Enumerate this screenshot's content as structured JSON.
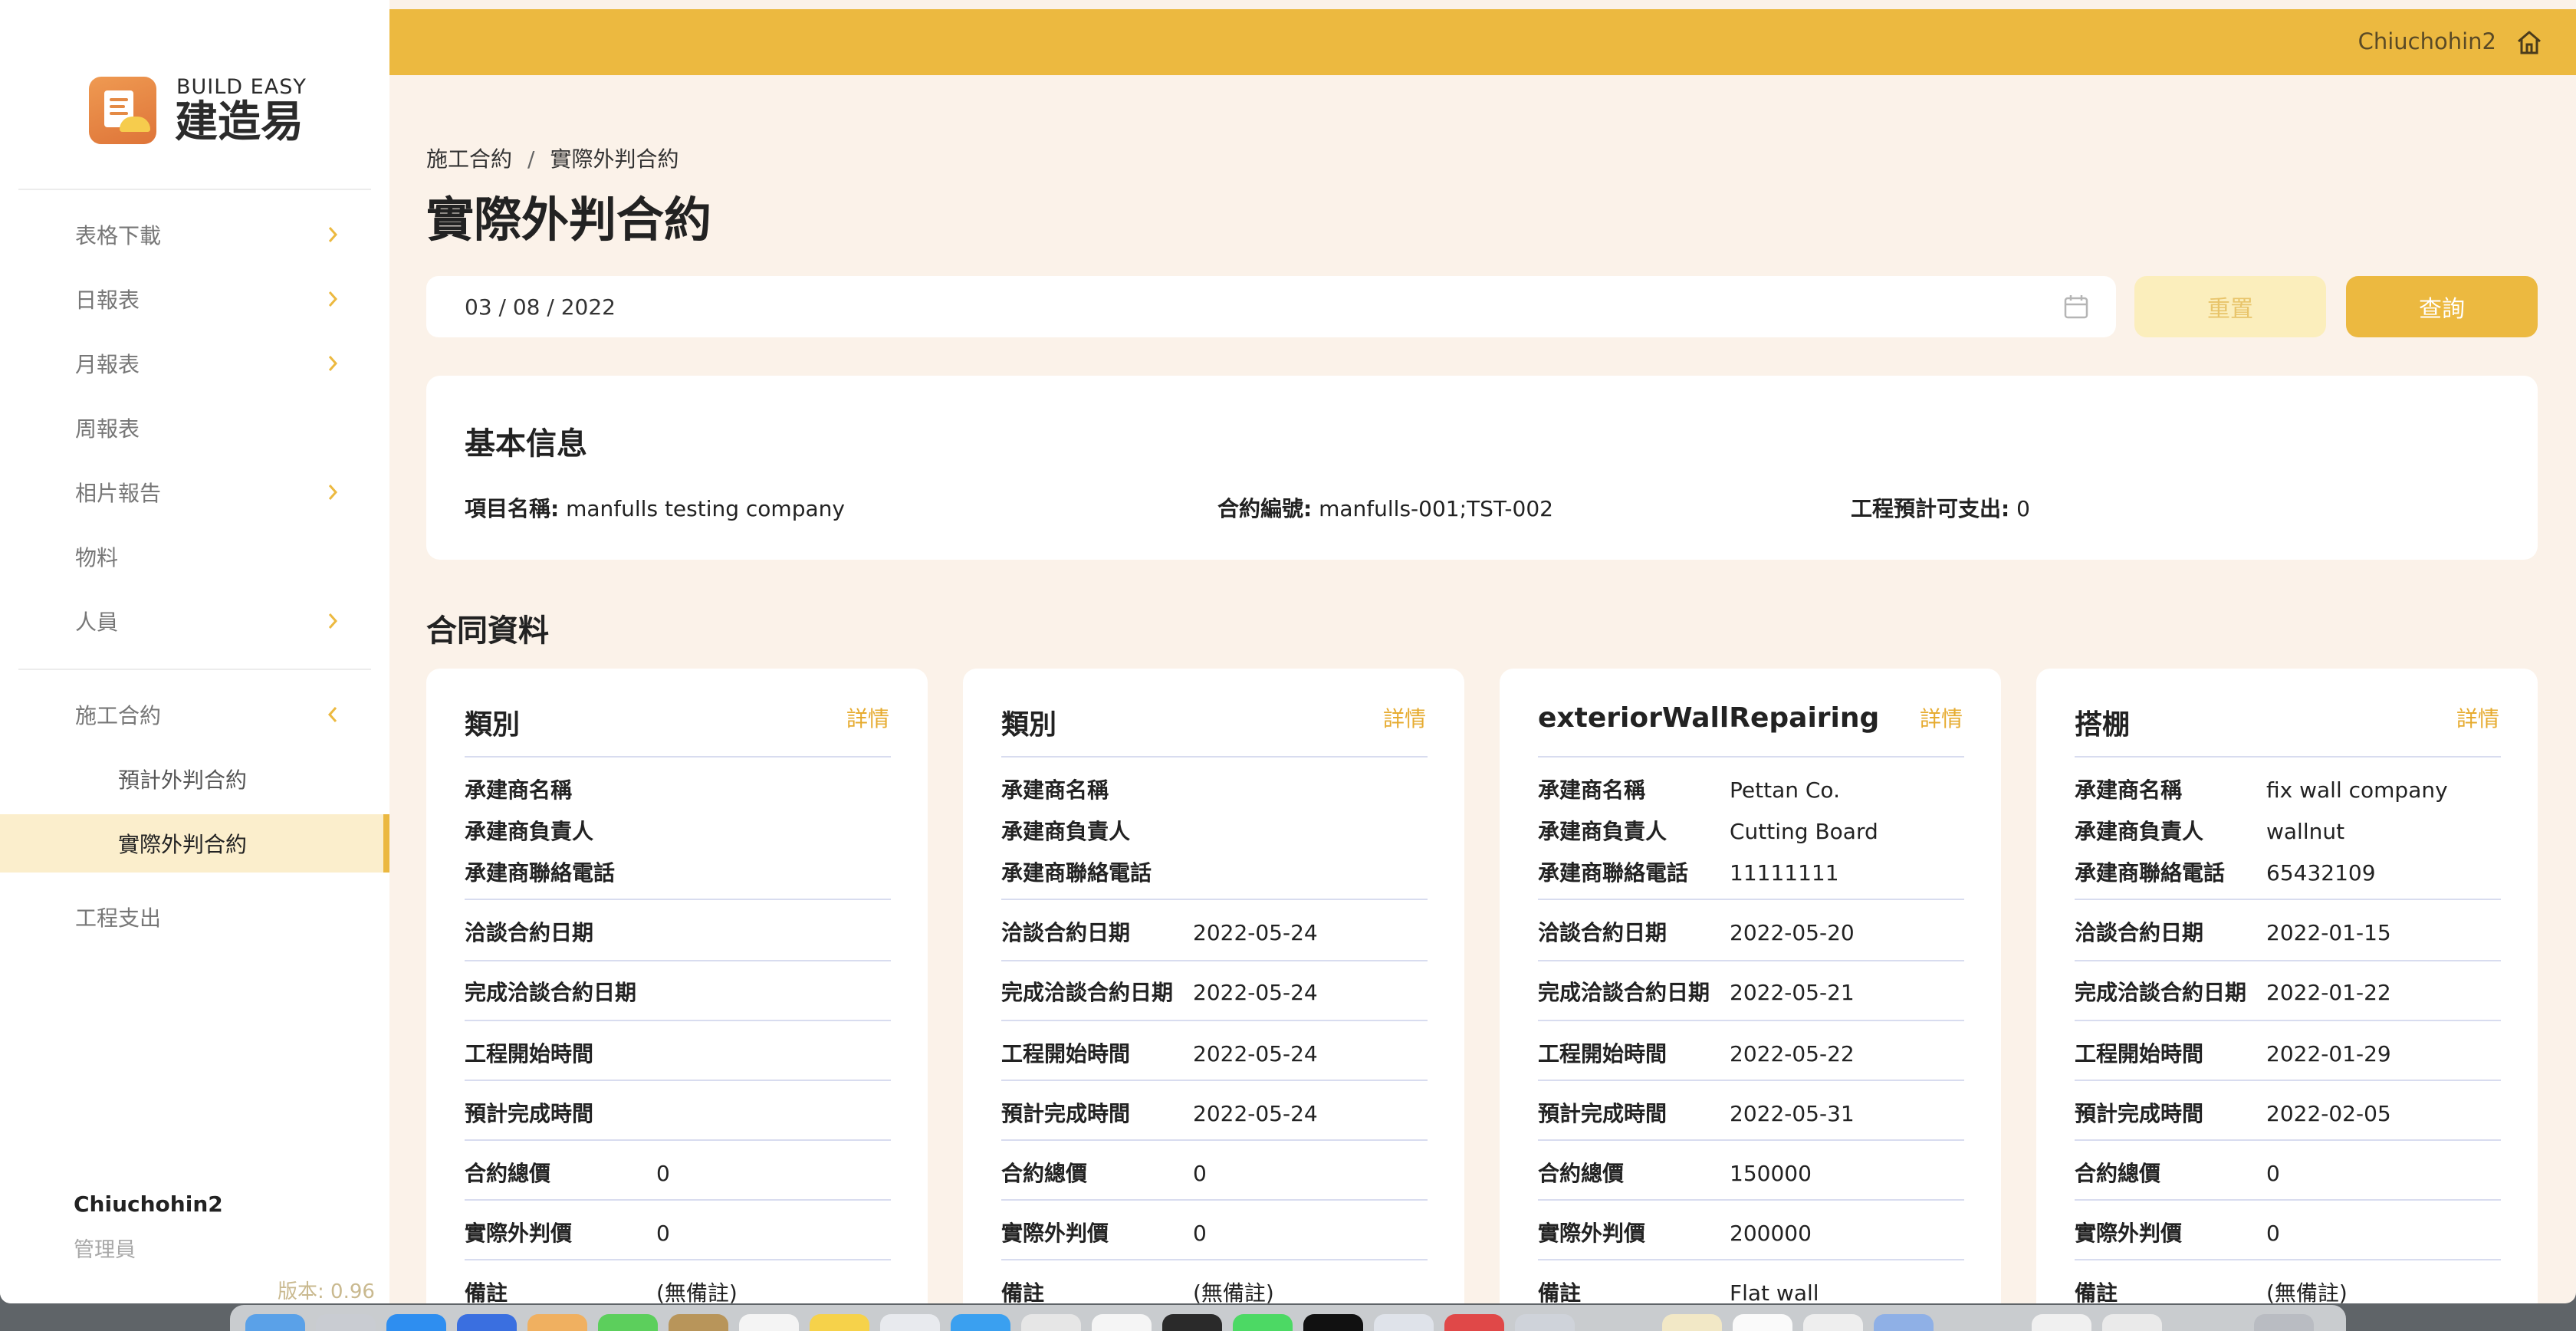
{
  "brand": {
    "en": "BUILD EASY",
    "zh": "建造易"
  },
  "sidebar": {
    "items": [
      {
        "label": "表格下載",
        "chevron": "right"
      },
      {
        "label": "日報表",
        "chevron": "right"
      },
      {
        "label": "月報表",
        "chevron": "right"
      },
      {
        "label": "周報表",
        "chevron": ""
      },
      {
        "label": "相片報告",
        "chevron": "right"
      },
      {
        "label": "物料",
        "chevron": ""
      },
      {
        "label": "人員",
        "chevron": "right"
      }
    ],
    "group": {
      "label": "施工合約",
      "chevron": "left",
      "children": [
        "預計外判合約",
        "實際外判合約"
      ],
      "active_child": "實際外判合約"
    },
    "after": {
      "label": "工程支出"
    },
    "user": {
      "name": "Chiuchohin2",
      "role": "管理員"
    },
    "version": "版本: 0.96"
  },
  "topbar": {
    "user": "Chiuchohin2",
    "home_icon": "home-icon"
  },
  "breadcrumb": {
    "parent": "施工合約",
    "separator": "/",
    "current": "實際外判合約"
  },
  "page_title": "實際外判合約",
  "filter": {
    "date_value": "03 / 08 / 2022",
    "reset_label": "重置",
    "query_label": "查詢"
  },
  "basic_info": {
    "title": "基本信息",
    "project_label": "項目名稱:",
    "project_value": "manfulls testing company",
    "contract_no_label": "合約編號:",
    "contract_no_value": "manfulls-001;TST-002",
    "budget_label": "工程預計可支出:",
    "budget_value": "0"
  },
  "contracts_title": "合同資料",
  "labels": {
    "contractor_name": "承建商名稱",
    "contractor_lead": "承建商負責人",
    "contractor_phone": "承建商聯絡電話",
    "negotiation_date": "洽談合約日期",
    "negotiation_done_date": "完成洽談合約日期",
    "start_date": "工程開始時間",
    "expected_finish": "預計完成時間",
    "total_price": "合約總價",
    "actual_price": "實際外判價",
    "remarks": "備註"
  },
  "contracts": [
    {
      "title": "類別",
      "detail": "詳情",
      "contractor_name": "",
      "contractor_lead": "",
      "contractor_phone": "",
      "negotiation_date": "",
      "negotiation_done_date": "",
      "start_date": "",
      "expected_finish": "",
      "total_price": "0",
      "actual_price": "0",
      "remarks": "(無備註)"
    },
    {
      "title": "類別",
      "detail": "詳情",
      "contractor_name": "",
      "contractor_lead": "",
      "contractor_phone": "",
      "negotiation_date": "2022-05-24",
      "negotiation_done_date": "2022-05-24",
      "start_date": "2022-05-24",
      "expected_finish": "2022-05-24",
      "total_price": "0",
      "actual_price": "0",
      "remarks": "(無備註)"
    },
    {
      "title": "exteriorWallRepairing",
      "detail": "詳情",
      "contractor_name": "Pettan Co.",
      "contractor_lead": "Cutting Board",
      "contractor_phone": "11111111",
      "negotiation_date": "2022-05-20",
      "negotiation_done_date": "2022-05-21",
      "start_date": "2022-05-22",
      "expected_finish": "2022-05-31",
      "total_price": "150000",
      "actual_price": "200000",
      "remarks": "Flat wall"
    },
    {
      "title": "搭棚",
      "detail": "詳情",
      "contractor_name": "fix wall company",
      "contractor_lead": "wallnut",
      "contractor_phone": "65432109",
      "negotiation_date": "2022-01-15",
      "negotiation_done_date": "2022-01-22",
      "start_date": "2022-01-29",
      "expected_finish": "2022-02-05",
      "total_price": "0",
      "actual_price": "0",
      "remarks": "(無備註)"
    }
  ]
}
